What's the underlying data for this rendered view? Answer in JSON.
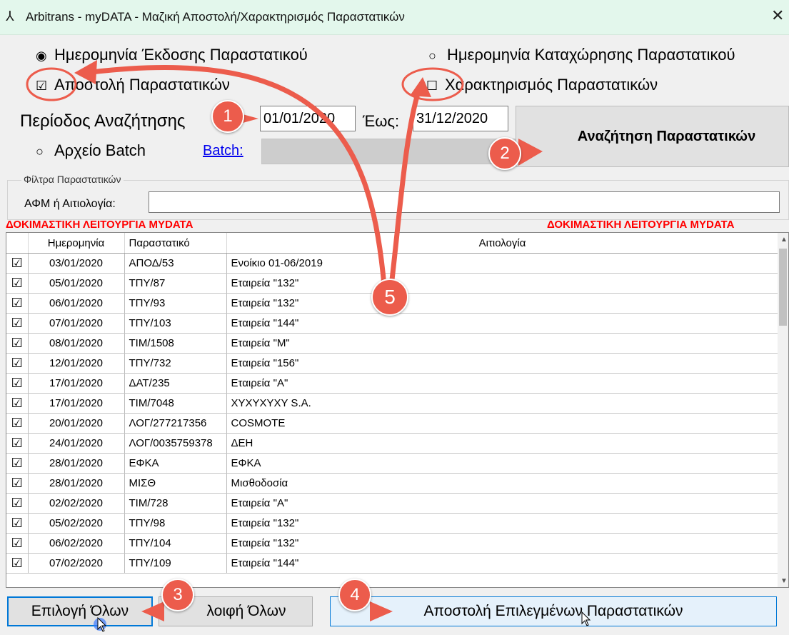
{
  "window": {
    "title": "Arbitrans - myDATA - Μαζική Αποστολή/Χαρακτηρισμός Παραστατικών",
    "app_icon": "⅄",
    "close_glyph": "✕"
  },
  "options": {
    "issue_date_label": "Ημερομηνία Έκδοσης Παραστατικού",
    "registration_date_label": "Ημερομηνία Καταχώρησης Παραστατικού",
    "send_docs_label": "Αποστολή Παραστατικών",
    "characterize_docs_label": "Χαρακτηρισμός Παραστατικών",
    "batch_file_label": "Αρχείο Batch",
    "radio_on": "◉",
    "radio_off": "○",
    "check_on": "☑",
    "check_off": "☐"
  },
  "search": {
    "period_label": "Περίοδος Αναζήτησης",
    "from_value": "01/01/2020",
    "to_label": "Έως:",
    "to_value": "31/12/2020",
    "button_label": "Αναζήτηση Παραστατικών",
    "batch_link": "Batch:"
  },
  "filters": {
    "legend": "Φίλτρα Παραστατικών",
    "afm_label": "ΑΦΜ ή Αιτιολογία:",
    "afm_value": ""
  },
  "test_mode_text": "ΔΟΚΙΜΑΣΤΙΚΗ ΛΕΙΤΟΥΡΓΙΑ MYDATA",
  "table": {
    "headers": [
      "Ημερομηνία",
      "Παραστατικό",
      "Αιτιολογία"
    ],
    "rows": [
      {
        "checked": "☑",
        "date": "03/01/2020",
        "doc": "ΑΠΟΔ/53",
        "reason": "Ενοίκιο 01-06/2019"
      },
      {
        "checked": "☑",
        "date": "05/01/2020",
        "doc": "ΤΠΥ/87",
        "reason": "Εταιρεία \"132\""
      },
      {
        "checked": "☑",
        "date": "06/01/2020",
        "doc": "ΤΠΥ/93",
        "reason": "Εταιρεία \"132\""
      },
      {
        "checked": "☑",
        "date": "07/01/2020",
        "doc": "ΤΠΥ/103",
        "reason": "Εταιρεία \"144\""
      },
      {
        "checked": "☑",
        "date": "08/01/2020",
        "doc": "ΤΙΜ/1508",
        "reason": "Εταιρεία \"M\""
      },
      {
        "checked": "☑",
        "date": "12/01/2020",
        "doc": "ΤΠΥ/732",
        "reason": "Εταιρεία \"156\""
      },
      {
        "checked": "☑",
        "date": "17/01/2020",
        "doc": "ΔΑΤ/235",
        "reason": "Εταιρεία \"A\""
      },
      {
        "checked": "☑",
        "date": "17/01/2020",
        "doc": "ΤΙΜ/7048",
        "reason": "XYXYXYXY S.A."
      },
      {
        "checked": "☑",
        "date": "20/01/2020",
        "doc": "ΛΟΓ/277217356",
        "reason": "COSMOTE"
      },
      {
        "checked": "☑",
        "date": "24/01/2020",
        "doc": "ΛΟΓ/0035759378",
        "reason": "ΔΕΗ"
      },
      {
        "checked": "☑",
        "date": "28/01/2020",
        "doc": "ΕΦΚΑ",
        "reason": "ΕΦΚΑ"
      },
      {
        "checked": "☑",
        "date": "28/01/2020",
        "doc": "ΜΙΣΘ",
        "reason": "Μισθοδοσία"
      },
      {
        "checked": "☑",
        "date": "02/02/2020",
        "doc": "ΤΙΜ/728",
        "reason": "Εταιρεία \"A\""
      },
      {
        "checked": "☑",
        "date": "05/02/2020",
        "doc": "ΤΠΥ/98",
        "reason": "Εταιρεία \"132\""
      },
      {
        "checked": "☑",
        "date": "06/02/2020",
        "doc": "ΤΠΥ/104",
        "reason": "Εταιρεία \"132\""
      },
      {
        "checked": "☑",
        "date": "07/02/2020",
        "doc": "ΤΠΥ/109",
        "reason": "Εταιρεία \"144\""
      }
    ]
  },
  "buttons": {
    "select_all": "Επιλογή Όλων",
    "remove_all": "λοιφή Όλων",
    "send_selected": "Αποστολή Επιλεγμένων Παραστατικών"
  },
  "annotations": {
    "step1": "1",
    "step2": "2",
    "step3": "3",
    "step4": "4",
    "step5": "5",
    "color": "#ec5c4c"
  }
}
